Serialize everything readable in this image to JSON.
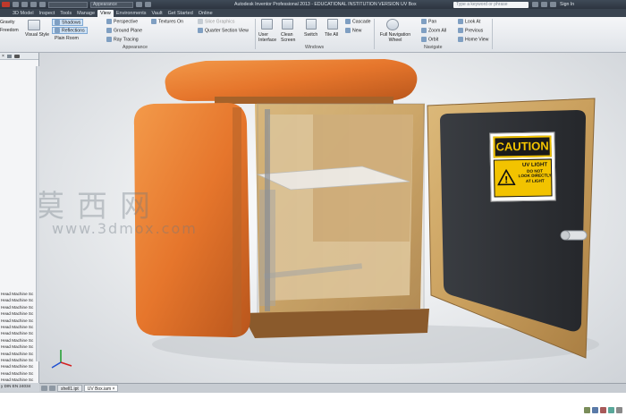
{
  "titlebar": {
    "file_select": "",
    "appearance_select": "Appearance",
    "title": "Autodesk Inventor Professional 2013 - EDUCATIONAL INSTITUTION VERSION    UV Box",
    "search_placeholder": "Type a keyword or phrase",
    "sign_in": "Sign In"
  },
  "tabs": [
    "3D Model",
    "Inspect",
    "Tools",
    "Manage",
    "View",
    "Environments",
    "Vault",
    "Get Started",
    "Online"
  ],
  "active_tab": "View",
  "ribbon": {
    "visibility_partial_1": "Gravity",
    "visibility_partial_2": "Freedom",
    "visual_style": "Visual Style",
    "shadows": "Shadows",
    "reflections": "Reflections",
    "scene": "Plain Room",
    "perspective": "Perspective",
    "ground_plane": "Ground Plane",
    "ray_tracing": "Ray Tracing",
    "textures_on": "Textures On",
    "slice_graphics": "Slice Graphics",
    "quarter_section": "Quarter Section View",
    "appearance_panel": "Appearance",
    "user_interface": "User Interface",
    "clean_screen": "Clean Screen",
    "switch": "Switch",
    "tile_all": "Tile All",
    "cascade": "Cascade",
    "new": "New",
    "windows_panel": "Windows",
    "full_navigation_wheel": "Full Navigation Wheel",
    "pan": "Pan",
    "zoom_all": "Zoom All",
    "orbit": "Orbit",
    "look_at": "Look At",
    "previous": "Previous",
    "home_view": "Home View",
    "navigate_panel": "Navigate"
  },
  "browser": {
    "items": [
      "Head Machine Sc",
      "Head Machine Sc",
      "Head Machine Sc",
      "Head Machine Sc",
      "Head Machine Sc",
      "Head Machine Sc",
      "Head Machine Sc",
      "Head Machine Sc",
      "Head Machine Sc",
      "Head Machine Sc",
      "Head Machine Sc",
      "Head Machine Sc",
      "Head Machine Sc",
      "Head Machine Sc",
      "y DIN EN 24034",
      "y DIN EN 24034",
      "y DIN EN 24034",
      "y DIN EN 24034"
    ]
  },
  "watermark": {
    "chinese": "莫西网",
    "url": "www.3dmox.com"
  },
  "caution_sign": {
    "header": "CAUTION",
    "line1": "UV LIGHT",
    "line2": "DO NOT",
    "line3": "LOOK DIRECTLY",
    "line4": "AT LIGHT"
  },
  "document_tabs": [
    "shell1.ipt",
    "UV Box.iam"
  ],
  "colors": {
    "accent_active": "#cfe3f7",
    "cushion_orange": "#e8772a",
    "wood": "#c9a264",
    "caution_yellow": "#f2c300"
  }
}
